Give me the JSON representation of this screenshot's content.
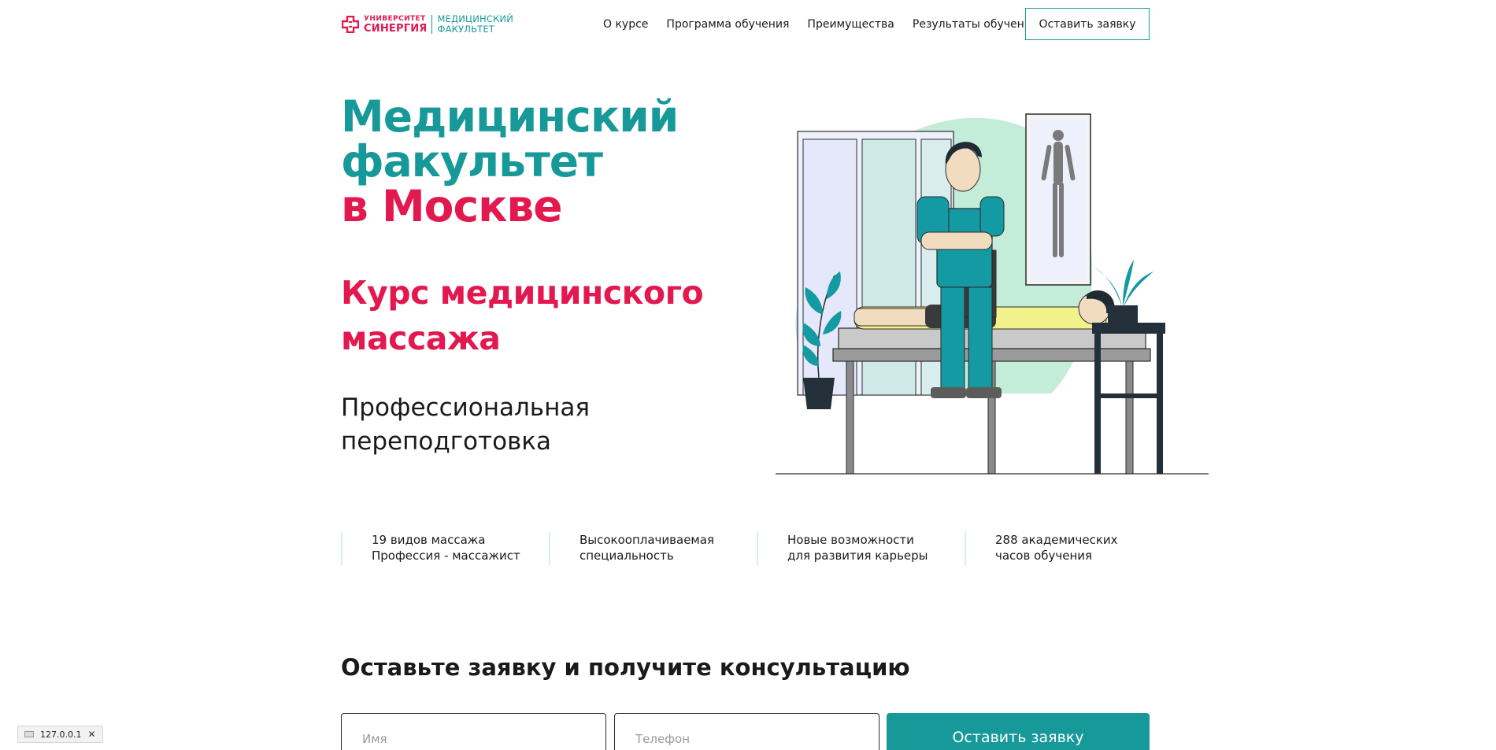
{
  "brand": {
    "line1": "УНИВЕРСИТЕТ",
    "line2": "СИНЕРГИЯ",
    "faculty_line1": "МЕДИЦИНСКИЙ",
    "faculty_line2": "ФАКУЛЬТЕТ",
    "primary_color": "#17999a",
    "accent_color": "#e3184e"
  },
  "nav": {
    "items": [
      {
        "label": "О курсе"
      },
      {
        "label": "Программа обучения"
      },
      {
        "label": "Преимущества"
      },
      {
        "label": "Результаты обучения"
      }
    ],
    "cta_label": "Оставить заявку"
  },
  "hero": {
    "title_line1": "Медицинский",
    "title_line2": "факультет",
    "title_line3": "в Москве",
    "course_title": "Курс медицинского массажа",
    "subtitle": "Профессиональная переподготовка"
  },
  "features": [
    {
      "line1": "19 видов массажа",
      "line2": "Профессия - массажист"
    },
    {
      "line1": "Высокооплачиваемая",
      "line2": "специальность"
    },
    {
      "line1": "Новые возможности",
      "line2": "для развития карьеры"
    },
    {
      "line1": "288 академических",
      "line2": "часов обучения"
    }
  ],
  "form": {
    "title": "Оставьте заявку и получите консультацию",
    "name_placeholder": "Имя",
    "phone_placeholder": "Телефон",
    "submit_label": "Оставить заявку"
  },
  "status": {
    "host": "127.0.0.1",
    "close_glyph": "✕"
  }
}
